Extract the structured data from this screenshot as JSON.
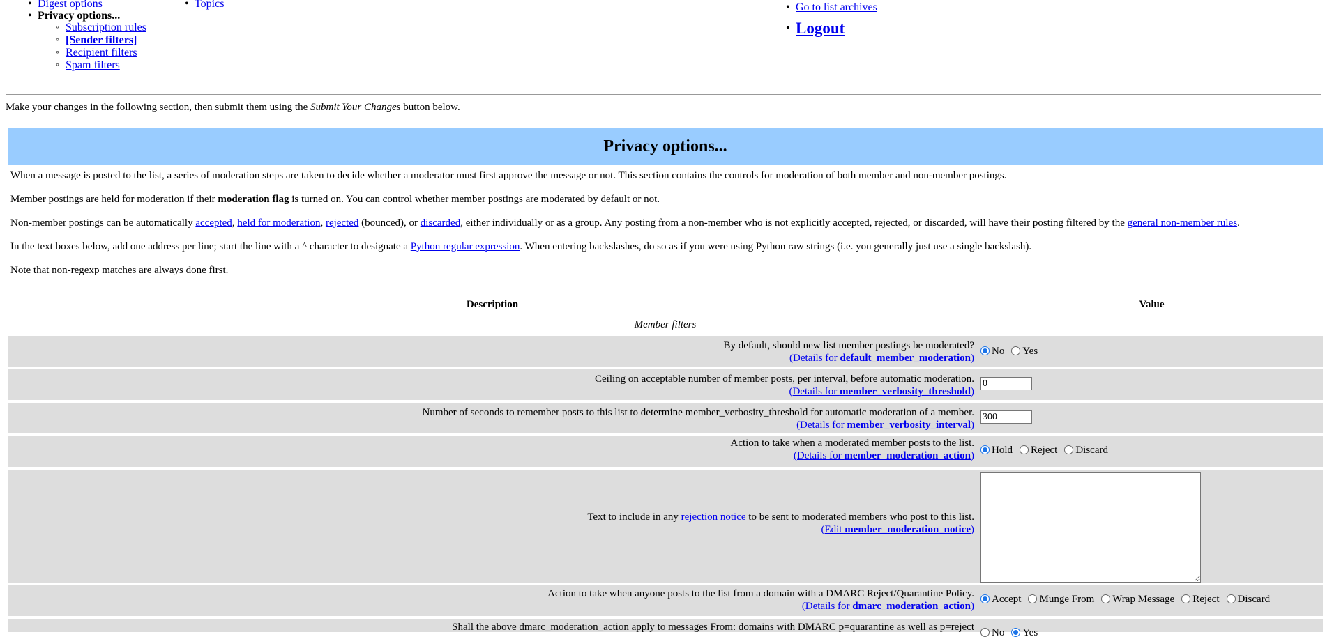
{
  "nav": {
    "col_a": {
      "digest_link": "Digest options",
      "privacy_label": "Privacy options...",
      "sub_items": [
        {
          "label": "Subscription rules"
        },
        {
          "label": "[Sender filters]"
        },
        {
          "label": "Recipient filters"
        },
        {
          "label": "Spam filters"
        }
      ]
    },
    "col_b": {
      "topics_link": "Topics"
    },
    "col_c": {
      "archives_link": "Go to list archives",
      "logout_link": "Logout"
    }
  },
  "intro": {
    "before": "Make your changes in the following section, then submit them using the ",
    "button_ref": "Submit Your Changes",
    "after": " button below."
  },
  "section": {
    "title": "Privacy options...",
    "p1": "When a message is posted to the list, a series of moderation steps are taken to decide whether a moderator must first approve the message or not. This section contains the controls for moderation of both member and non-member postings.",
    "p2_before": "Member postings are held for moderation if their ",
    "p2_bold": "moderation flag",
    "p2_after": " is turned on. You can control whether member postings are moderated by default or not.",
    "p3_a": "Non-member postings can be automatically ",
    "p3_accepted": "accepted",
    "p3_held": "held for moderation",
    "p3_rejected": "rejected",
    "p3_b": " (bounced), or ",
    "p3_discarded": "discarded",
    "p3_c": ", either individually or as a group. Any posting from a non-member who is not explicitly accepted, rejected, or discarded, will have their posting filtered by the ",
    "p3_general": "general non-member rules",
    "p4_a": "In the text boxes below, add one address per line; start the line with a ^ character to designate a ",
    "p4_link": "Python regular expression",
    "p4_b": ". When entering backslashes, do so as if you were using Python raw strings (i.e. you generally just use a single backslash).",
    "p5": "Note that non-regexp matches are always done first."
  },
  "table": {
    "col_description": "Description",
    "col_value": "Value",
    "category": "Member filters",
    "rows": [
      {
        "label": "By default, should new list member postings be moderated?",
        "details_prefix": "(Details for ",
        "details_name": "default_member_moderation",
        "options": [
          "No",
          "Yes"
        ],
        "selected": "No"
      },
      {
        "label": "Ceiling on acceptable number of member posts, per interval, before automatic moderation.",
        "details_prefix": "(Details for ",
        "details_name": "member_verbosity_threshold",
        "value": "0"
      },
      {
        "label": "Number of seconds to remember posts to this list to determine member_verbosity_threshold for automatic moderation of a member.",
        "details_prefix": "(Details for ",
        "details_name": "member_verbosity_interval",
        "value": "300"
      },
      {
        "label": "Action to take when a moderated member posts to the list.",
        "details_prefix": "(Details for ",
        "details_name": "member_moderation_action",
        "options": [
          "Hold",
          "Reject",
          "Discard"
        ],
        "selected": "Hold"
      },
      {
        "label_before": "Text to include in any ",
        "label_link": "rejection notice",
        "label_after": " to be sent to moderated members who post to this list.",
        "details_prefix": "(Edit ",
        "details_name": "member_moderation_notice",
        "value": ""
      },
      {
        "label": "Action to take when anyone posts to the list from a domain with a DMARC Reject/Quarantine Policy.",
        "details_prefix": "(Details for ",
        "details_name": "dmarc_moderation_action",
        "options": [
          "Accept",
          "Munge From",
          "Wrap Message",
          "Reject",
          "Discard"
        ],
        "selected": "Accept"
      },
      {
        "label": "Shall the above dmarc_moderation_action apply to messages From: domains with DMARC p=quarantine as well as p=reject",
        "options": [
          "No",
          "Yes"
        ],
        "selected": "Yes"
      }
    ]
  },
  "colors": {
    "header_bg": "#99ccff",
    "row_bg": "#dddddd",
    "link": "#0000ee"
  }
}
